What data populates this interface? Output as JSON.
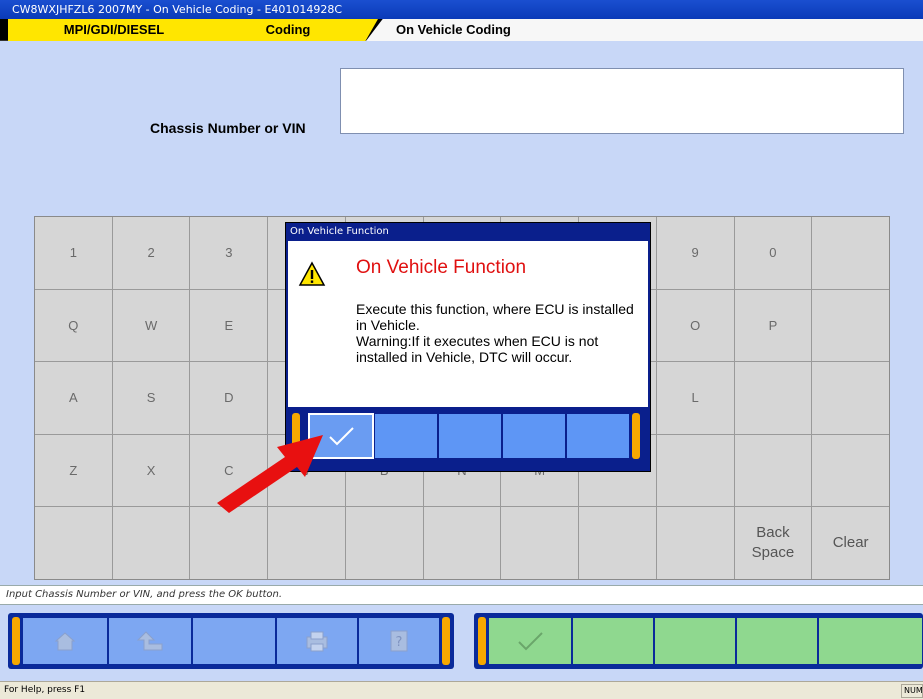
{
  "window": {
    "title": "CW8WXJHFZL6 2007MY   -  On Vehicle Coding  -  E401014928C"
  },
  "breadcrumb": {
    "items": [
      {
        "label": "MPI/GDI/DIESEL"
      },
      {
        "label": "Coding"
      },
      {
        "label": "On Vehicle Coding"
      }
    ]
  },
  "form": {
    "vin_label": "Chassis Number or VIN",
    "vin_value": ""
  },
  "keyboard": {
    "keys": [
      "1",
      "2",
      "3",
      "",
      "",
      "",
      "",
      "",
      "9",
      "0",
      "",
      "Q",
      "W",
      "E",
      "",
      "",
      "",
      "",
      "",
      "O",
      "P",
      "",
      "A",
      "S",
      "D",
      "",
      "",
      "",
      "",
      "",
      "L",
      "",
      "",
      "Z",
      "X",
      "C",
      "V",
      "B",
      "N",
      "M",
      "",
      "",
      "",
      "",
      "",
      "",
      "",
      "",
      "",
      "",
      "",
      "",
      "",
      "Back\nSpace",
      "Clear"
    ]
  },
  "status": {
    "instruction": "Input Chassis Number or VIN, and press the OK button."
  },
  "toolbar": {
    "left_icons": [
      "home-icon",
      "back-icon",
      "",
      "print-icon",
      "help-icon"
    ],
    "right_icons": [
      "check-icon",
      "",
      "",
      "",
      ""
    ]
  },
  "dialog": {
    "title": "On Vehicle Function",
    "heading": "On Vehicle Function",
    "message": "Execute this function, where ECU is installed in Vehicle.\nWarning:If it executes when ECU is not installed in Vehicle, DTC will occur.",
    "icon": "warning-icon",
    "ok_icon": "check-icon"
  },
  "statusbar": {
    "help": "For Help, press F1",
    "num": "NUM"
  },
  "colors": {
    "breadcrumb_active": "#ffe600",
    "dialog_heading": "#e01010",
    "annotation_arrow": "#e81010",
    "toolbar_green": "#8fd88f",
    "toolbar_blue": "#7da7f2"
  }
}
